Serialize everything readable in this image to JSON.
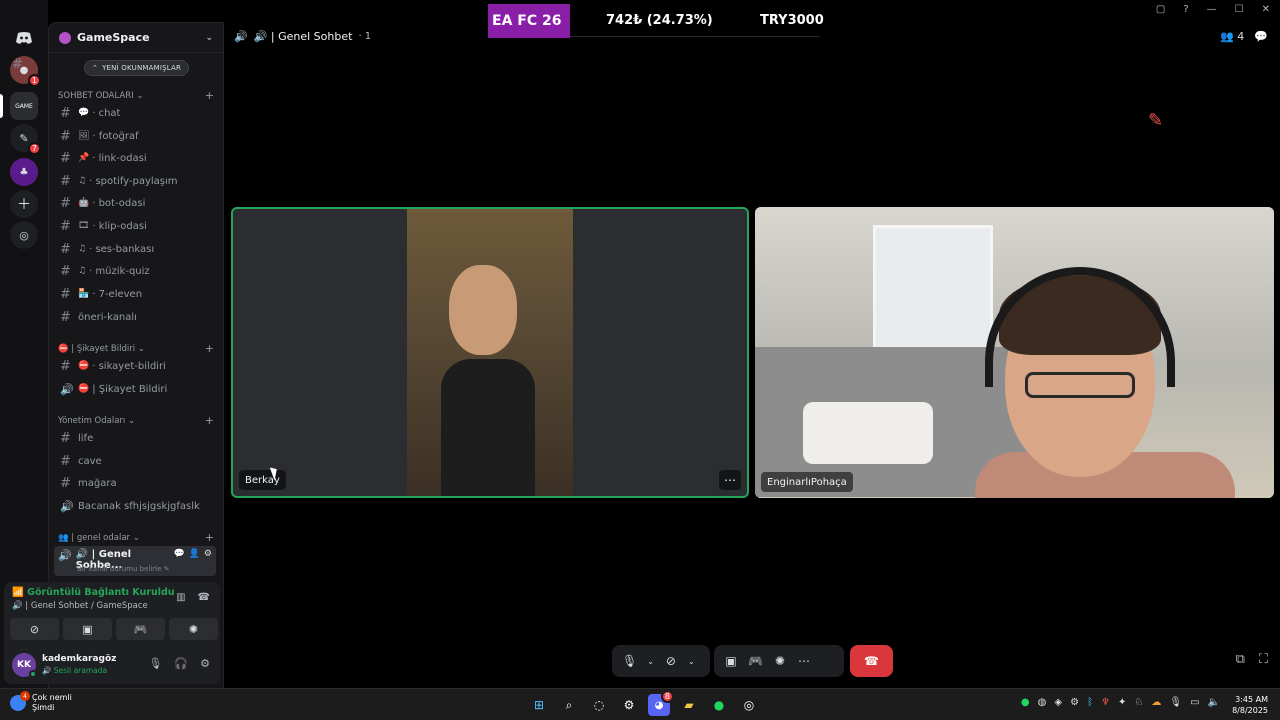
{
  "rail": {
    "items": [
      {
        "icon": "discord-logo-icon"
      },
      {
        "icon": "server-avatar-icon",
        "badge": "1"
      },
      {
        "icon": "gamespace-server-icon"
      },
      {
        "icon": "server-icon",
        "badge": "7"
      },
      {
        "icon": "purple-server-icon"
      },
      {
        "icon": "add-server-icon"
      },
      {
        "icon": "explore-icon"
      }
    ]
  },
  "guild": {
    "name": "GameSpace"
  },
  "unread_pill": "YENİ OKUNMAMIŞLAR",
  "categories": {
    "sohbet": "SOHBET ODALARI",
    "sikayet": "⛔ | Şikayet Bildiri",
    "yonetim": "Yönetim Odaları",
    "genel": "👥 | genel odalar"
  },
  "channels": {
    "chat": "chat",
    "fotograf": "fotoğraf",
    "link": "link-odasi",
    "spotify": "spotify-paylaşım",
    "bot": "bot-odasi",
    "klip": "klip-odasi",
    "ses": "ses-bankası",
    "muzik": "müzik-quiz",
    "eleven": "7-eleven",
    "oneri": "öneri-kanalı",
    "sikayet_text": "sikayet-bildiri",
    "sikayet_voice": "Şikayet Bildiri",
    "life": "life",
    "cave": "cave",
    "magara": "mağara",
    "bacanak": "Bacanak sfhjsjgskjgfaslk",
    "genel_sohbet": "🔊 | Genel Sohbe...",
    "genel_status": "Bir kanal durumu belirle"
  },
  "voice_panel": {
    "title": "Görüntülü Bağlantı Kuruldu",
    "subtitle": "🔊 | Genel Sohbet  /  GameSpace"
  },
  "user": {
    "initials": "KK",
    "name": "kademkaragöz",
    "status": "Sesli aramada"
  },
  "header": {
    "channel": "🔊 | Genel Sohbet",
    "count": "1",
    "member_count": "4"
  },
  "overlay": {
    "ea": "EA FC 26",
    "price": "742₺ (24.73%)",
    "try": "TRY3000"
  },
  "tiles": {
    "left_name": "Berkay",
    "right_name": "EnginarlıPohaça"
  },
  "taskbar": {
    "weather_badge": "4",
    "weather_line1": "Çok nemli",
    "weather_line2": "Şimdi",
    "discord_badge": "8",
    "time": "3:45 AM",
    "date": "8/8/2025"
  },
  "colors": {
    "accent_green": "#23a55a",
    "leave_red": "#da373c",
    "ea_purple": "#8a1fa7"
  }
}
